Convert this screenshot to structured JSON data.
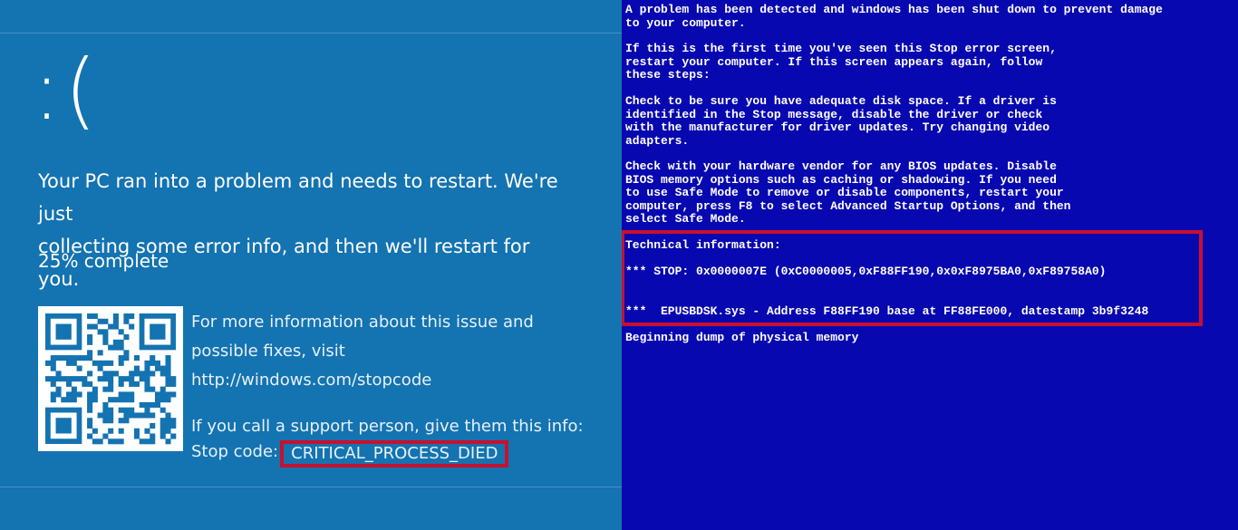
{
  "modern_bsod": {
    "background_color": "#1473b1",
    "sad_face": ":(",
    "headline_line1": "Your PC ran into a problem and needs to restart. We're just",
    "headline_line2": "collecting some error info, and then we'll restart for you.",
    "progress": {
      "percent": 25,
      "text": "25% complete"
    },
    "qr_code_icon": "qr-code",
    "info_line1": "For more information about this issue and",
    "info_line2": "possible fixes, visit",
    "info_url": "http://windows.com/stopcode",
    "support_line": "If you call a support person, give them this info:",
    "stop_code_label": "Stop code:",
    "stop_code": "CRITICAL_PROCESS_DIED",
    "highlight_color": "#c8102e"
  },
  "classic_bsod": {
    "background_color": "#0808b0",
    "para1": "A problem has been detected and windows has been shut down to prevent damage\nto your computer.",
    "para2": "If this is the first time you've seen this Stop error screen,\nrestart your computer. If this screen appears again, follow\nthese steps:",
    "para3": "Check to be sure you have adequate disk space. If a driver is\nidentified in the Stop message, disable the driver or check\nwith the manufacturer for driver updates. Try changing video\nadapters.",
    "para4": "Check with your hardware vendor for any BIOS updates. Disable\nBIOS memory options such as caching or shadowing. If you need\nto use Safe Mode to remove or disable components, restart your\ncomputer, press F8 to select Advanced Startup Options, and then\nselect Safe Mode.",
    "tech_header": "Technical information:",
    "stop_line": "*** STOP: 0x0000007E (0xC0000005,0xF88FF190,0x0xF8975BA0,0xF89758A0)",
    "driver_line": "***  EPUSBDSK.sys - Address F88FF190 base at FF88FE000, datestamp 3b9f3248",
    "dump_line": "Beginning dump of physical memory",
    "highlight_color": "#c8102e"
  }
}
